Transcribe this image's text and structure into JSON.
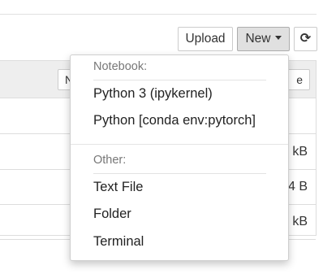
{
  "toolbar": {
    "upload_label": "Upload",
    "new_label": "New",
    "refresh_icon": "refresh-icon"
  },
  "listing": {
    "header_left_fragment": "N",
    "header_right_fragment": "e",
    "rows": [
      {
        "size": ""
      },
      {
        "size": "kB"
      },
      {
        "size": "4 B"
      },
      {
        "size": "kB"
      }
    ]
  },
  "new_menu": {
    "notebook_header": "Notebook:",
    "notebook_items": [
      "Python 3 (ipykernel)",
      "Python [conda env:pytorch]"
    ],
    "other_header": "Other:",
    "other_items": [
      "Text File",
      "Folder",
      "Terminal"
    ]
  }
}
